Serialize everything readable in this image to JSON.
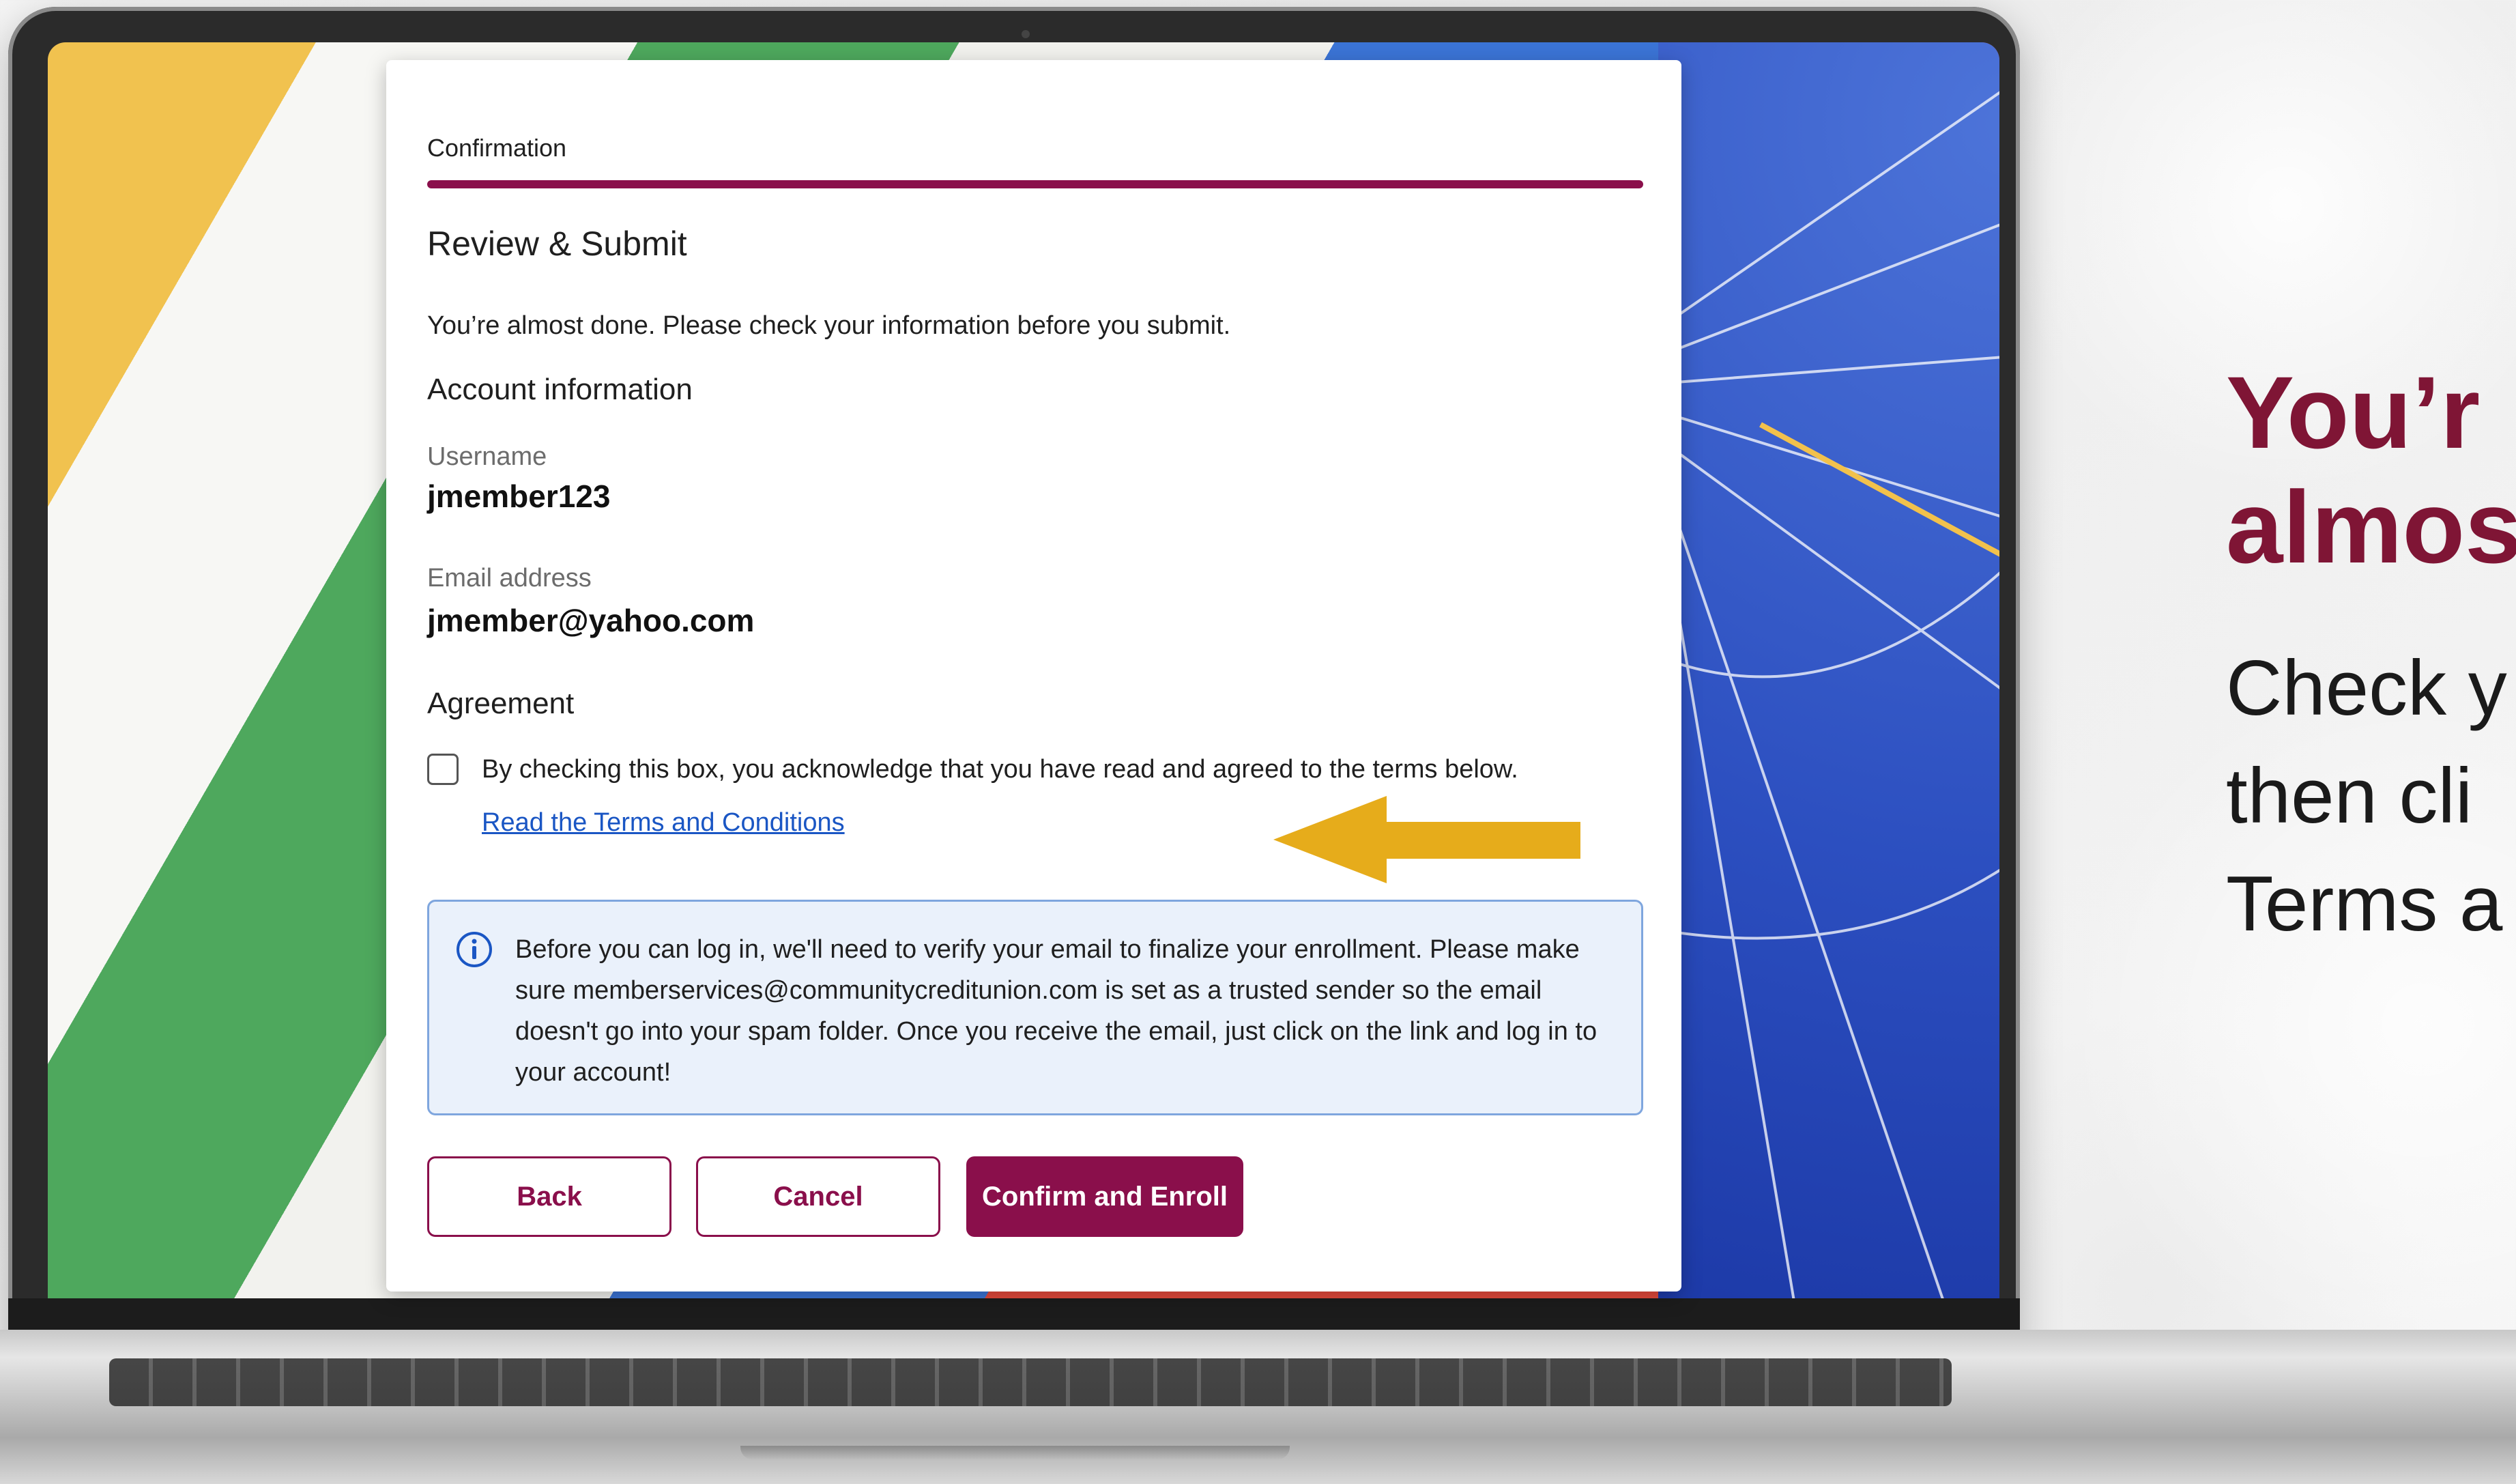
{
  "confirmation": {
    "step_label": "Confirmation",
    "section_title": "Review & Submit",
    "intro": "You’re almost done. Please check your information before you submit.",
    "account_heading": "Account information",
    "username_label": "Username",
    "username_value": "jmember123",
    "email_label": "Email address",
    "email_value": "jmember@yahoo.com",
    "agreement_heading": "Agreement",
    "agreement_checked": false,
    "agreement_text": "By checking this box, you acknowledge that you have read and agreed to the terms below.",
    "terms_link": "Read the Terms and Conditions",
    "info_text": "Before you can log in, we'll need to verify your email to finalize your enrollment. Please make sure memberservices@communitycreditunion.com is set as a trusted sender so the email doesn't go into your spam folder. Once you receive the email, just click on the link and log in to your account!",
    "buttons": {
      "back": "Back",
      "cancel": "Cancel",
      "confirm": "Confirm and Enroll"
    }
  },
  "side_panel": {
    "headline_line1": "You’r",
    "headline_line2": "almos",
    "body_line1": "Check y",
    "body_line2": "then cli",
    "body_line3": "Terms a"
  },
  "colors": {
    "brand": "#8a0f4b",
    "headline": "#7f1535",
    "link": "#1a56c4",
    "arrow": "#e6ac1b",
    "info_bg": "#eaf1fb"
  },
  "icons": {
    "info": "info-circle-icon",
    "arrow": "arrow-left-icon"
  }
}
